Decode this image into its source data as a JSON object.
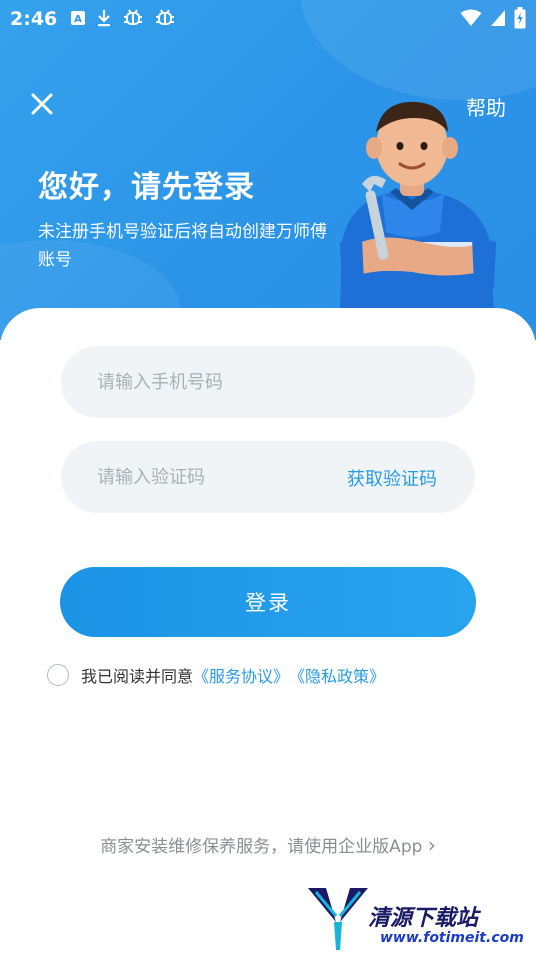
{
  "status_bar": {
    "time": "2:46",
    "left_icons": [
      "a-box-icon",
      "download-icon",
      "bug-icon",
      "bug-icon"
    ],
    "right_icons": [
      "wifi-icon",
      "signal-icon",
      "battery-icon"
    ]
  },
  "header": {
    "help_label": "帮助",
    "greeting": "您好，请先登录",
    "subtitle": "未注册手机号验证后将自动创建万师傅账号"
  },
  "form": {
    "phone_placeholder": "请输入手机号码",
    "code_placeholder": "请输入验证码",
    "get_code_label": "获取验证码",
    "login_label": "登录"
  },
  "agreement": {
    "prefix": "我已阅读并同意",
    "service_link": "《服务协议》",
    "privacy_link": "《隐私政策》"
  },
  "footer": {
    "enterprise_text": "商家安装维修保养服务，请使用企业版App",
    "chevron": "›"
  },
  "watermark": {
    "name": "清源下载站",
    "url": "www.fotimeit.com"
  },
  "colors": {
    "brand_blue": "#2b9ae5",
    "hero_bg": "#2c95e8",
    "field_bg": "#f0f4f6"
  }
}
